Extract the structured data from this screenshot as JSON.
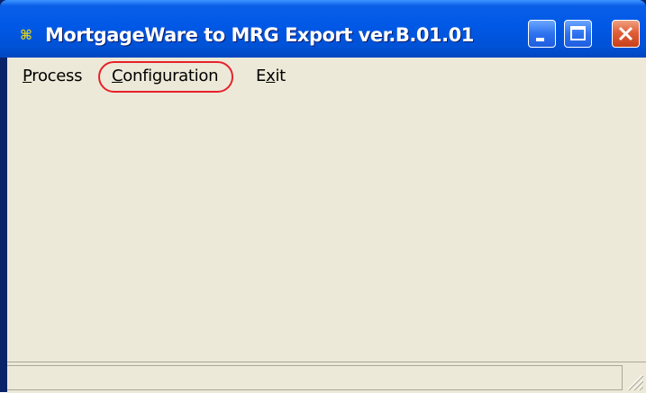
{
  "window": {
    "title": "MortgageWare to MRG Export ver.B.01.01",
    "icon": "app-icon"
  },
  "title_buttons": {
    "minimize": "minimize-icon",
    "maximize": "maximize-icon",
    "close": "close-icon"
  },
  "menubar": {
    "items": [
      {
        "label_prefix": "",
        "mnemonic": "P",
        "label_suffix": "rocess"
      },
      {
        "label_prefix": "",
        "mnemonic": "C",
        "label_suffix": "onfiguration"
      },
      {
        "label_prefix": "E",
        "mnemonic": "x",
        "label_suffix": "it"
      }
    ],
    "highlighted_item": "Configuration",
    "highlight_color": "#e8202a"
  },
  "colors": {
    "titlebar": "#0058e6",
    "client_background": "#ece9d8",
    "close_button": "#e0603a"
  },
  "statusbar": {
    "text": ""
  }
}
